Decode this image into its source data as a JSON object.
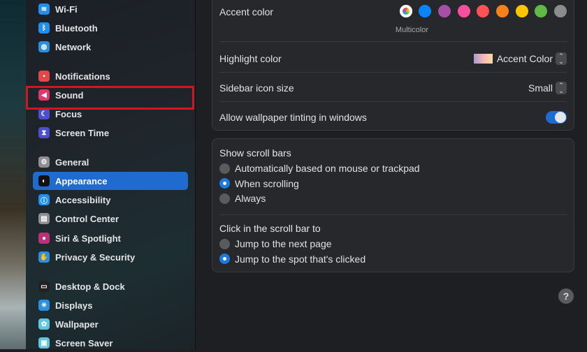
{
  "sidebar": {
    "items": [
      {
        "label": "Wi-Fi",
        "icon": "wifi-icon",
        "color": "#1f8ff0",
        "glyph": "≋"
      },
      {
        "label": "Bluetooth",
        "icon": "bluetooth-icon",
        "color": "#1f8ff0",
        "glyph": "ᛒ"
      },
      {
        "label": "Network",
        "icon": "globe-icon",
        "color": "#2b8fe0",
        "glyph": "◍"
      },
      {
        "label": "Notifications",
        "icon": "notifications-icon",
        "color": "#e0484a",
        "glyph": "▪"
      },
      {
        "label": "Sound",
        "icon": "speaker-icon",
        "color": "#e3366b",
        "glyph": "◀"
      },
      {
        "label": "Focus",
        "icon": "moon-icon",
        "color": "#4b4fd0",
        "glyph": "☾"
      },
      {
        "label": "Screen Time",
        "icon": "hourglass-icon",
        "color": "#4b4fd0",
        "glyph": "⧗"
      },
      {
        "label": "General",
        "icon": "gear-icon",
        "color": "#8e8e93",
        "glyph": "⚙"
      },
      {
        "label": "Appearance",
        "icon": "appearance-icon",
        "color": "#111",
        "glyph": "◐"
      },
      {
        "label": "Accessibility",
        "icon": "accessibility-icon",
        "color": "#1f8ff0",
        "glyph": "ⓘ"
      },
      {
        "label": "Control Center",
        "icon": "control-center-icon",
        "color": "#8e8e93",
        "glyph": "▤"
      },
      {
        "label": "Siri & Spotlight",
        "icon": "siri-icon",
        "color": "#c0307a",
        "glyph": "●"
      },
      {
        "label": "Privacy & Security",
        "icon": "hand-icon",
        "color": "#2b8fe0",
        "glyph": "✋"
      },
      {
        "label": "Desktop & Dock",
        "icon": "dock-icon",
        "color": "#222",
        "glyph": "▭"
      },
      {
        "label": "Displays",
        "icon": "sun-icon",
        "color": "#2b8fe0",
        "glyph": "☀"
      },
      {
        "label": "Wallpaper",
        "icon": "wallpaper-icon",
        "color": "#5ec6e0",
        "glyph": "✿"
      },
      {
        "label": "Screen Saver",
        "icon": "screen-saver-icon",
        "color": "#5ec6e0",
        "glyph": "▣"
      }
    ],
    "selected": "Appearance",
    "highlighted": "Sound"
  },
  "appearance": {
    "accent_label": "Accent color",
    "accent_colors": [
      "multicolor",
      "#0a84ff",
      "#a550a7",
      "#f74f9e",
      "#ff5257",
      "#f7821b",
      "#ffc600",
      "#62ba46",
      "#8c8c8c"
    ],
    "accent_selected": "Multicolor",
    "highlight_label": "Highlight color",
    "highlight_value": "Accent Color",
    "sidebar_icon_label": "Sidebar icon size",
    "sidebar_icon_value": "Small",
    "tinting_label": "Allow wallpaper tinting in windows",
    "tinting_on": true
  },
  "scroll": {
    "show_label": "Show scroll bars",
    "show_options": [
      "Automatically based on mouse or trackpad",
      "When scrolling",
      "Always"
    ],
    "show_selected": 1,
    "click_label": "Click in the scroll bar to",
    "click_options": [
      "Jump to the next page",
      "Jump to the spot that's clicked"
    ],
    "click_selected": 1
  },
  "help": "?"
}
